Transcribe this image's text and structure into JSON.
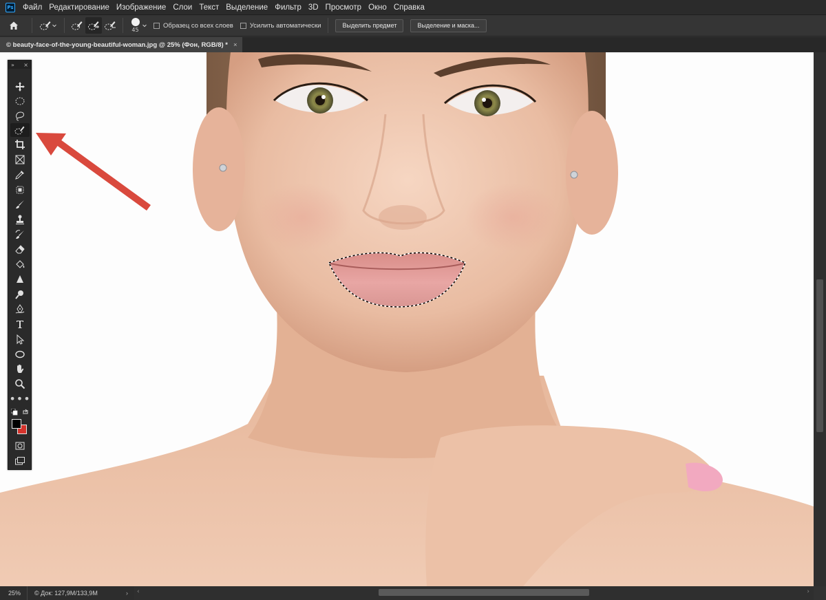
{
  "menu": {
    "logo": "Ps",
    "items": [
      "Файл",
      "Редактирование",
      "Изображение",
      "Слои",
      "Текст",
      "Выделение",
      "Фильтр",
      "3D",
      "Просмотр",
      "Окно",
      "Справка"
    ]
  },
  "options": {
    "brush_size": "45",
    "sample_all_layers": "Образец со всех слоев",
    "auto_enhance": "Усилить автоматически",
    "select_subject": "Выделить предмет",
    "select_and_mask": "Выделение и маска..."
  },
  "document": {
    "tab_title": "© beauty-face-of-the-young-beautiful-woman.jpg @ 25% (Фон, RGB/8) *",
    "close": "×"
  },
  "toolbar": {
    "collapse": "»",
    "close": "×",
    "active_tool": "quick-selection-tool",
    "more_tools": "•••"
  },
  "status": {
    "zoom": "25%",
    "doc_size": "© Док: 127,9M/133,9M",
    "arrow": "›"
  },
  "colors": {
    "foreground": "#000000",
    "background": "#d5332c",
    "annotation_arrow": "#d9493d",
    "accent": "#31a8ff"
  }
}
